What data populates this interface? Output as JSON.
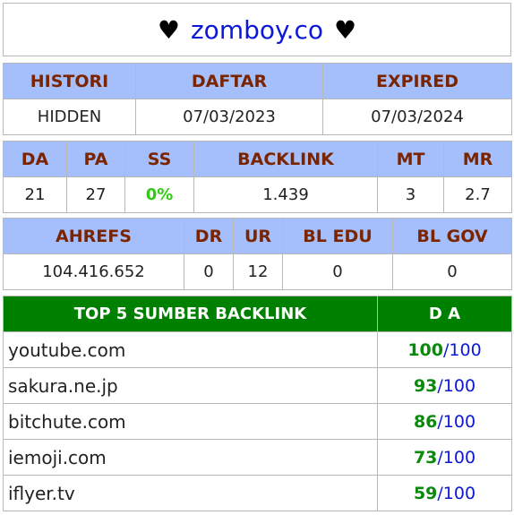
{
  "title": {
    "left_icon": "heart-icon",
    "right_icon": "heart-icon",
    "heart": "♥",
    "domain": "zomboy.co"
  },
  "t1": {
    "headers": [
      "HISTORI",
      "DAFTAR",
      "EXPIRED"
    ],
    "values": [
      "HIDDEN",
      "07/03/2023",
      "07/03/2024"
    ]
  },
  "t2": {
    "headers": [
      "DA",
      "PA",
      "SS",
      "BACKLINK",
      "MT",
      "MR"
    ],
    "values": [
      "21",
      "27",
      "0%",
      "1.439",
      "3",
      "2.7"
    ]
  },
  "t3": {
    "headers": [
      "AHREFS",
      "DR",
      "UR",
      "BL EDU",
      "BL GOV"
    ],
    "values": [
      "104.416.652",
      "0",
      "12",
      "0",
      "0"
    ]
  },
  "top": {
    "headers": [
      "TOP 5 SUMBER BACKLINK",
      "D A"
    ],
    "sep": "/",
    "max": "100",
    "rows": [
      {
        "site": "youtube.com",
        "da": "100"
      },
      {
        "site": "sakura.ne.jp",
        "da": "93"
      },
      {
        "site": "bitchute.com",
        "da": "86"
      },
      {
        "site": "iemoji.com",
        "da": "73"
      },
      {
        "site": "iflyer.tv",
        "da": "59"
      }
    ]
  }
}
